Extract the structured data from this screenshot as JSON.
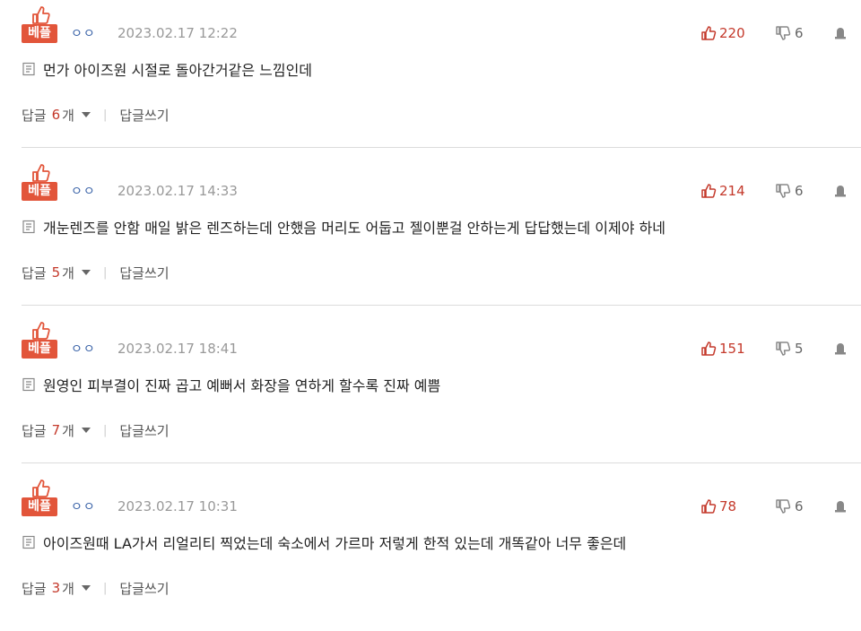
{
  "labels": {
    "best": "베플",
    "reply": "답글",
    "reply_unit": "개",
    "write_reply": "답글쓰기",
    "separator": "|"
  },
  "colors": {
    "accent_red": "#e2553a",
    "like_red": "#c4392b",
    "user_blue": "#3a63a8"
  },
  "icons": [
    "thumbs-up-icon",
    "thumbs-down-icon",
    "report-icon",
    "document-icon",
    "chevron-down-icon"
  ],
  "comments": [
    {
      "user": "ㅇㅇ",
      "date": "2023.02.17 12:22",
      "likes": "220",
      "dislikes": "6",
      "text": "먼가 아이즈원 시절로 돌아간거같은 느낌인데",
      "replies": "6"
    },
    {
      "user": "ㅇㅇ",
      "date": "2023.02.17 14:33",
      "likes": "214",
      "dislikes": "6",
      "text": "개눈렌즈를 안함 매일 밝은 렌즈하는데 안했음 머리도 어둡고 젤이뿐걸 안하는게 답답했는데 이제야 하네",
      "replies": "5"
    },
    {
      "user": "ㅇㅇ",
      "date": "2023.02.17 18:41",
      "likes": "151",
      "dislikes": "5",
      "text": "원영인 피부결이 진짜 곱고 예뻐서 화장을 연하게 할수록 진짜 예쁨",
      "replies": "7"
    },
    {
      "user": "ㅇㅇ",
      "date": "2023.02.17 10:31",
      "likes": "78",
      "dislikes": "6",
      "text": "아이즈원때 LA가서 리얼리티 찍었는데 숙소에서 가르마 저렇게 한적 있는데 개똑같아 너무 좋은데",
      "replies": "3"
    }
  ]
}
